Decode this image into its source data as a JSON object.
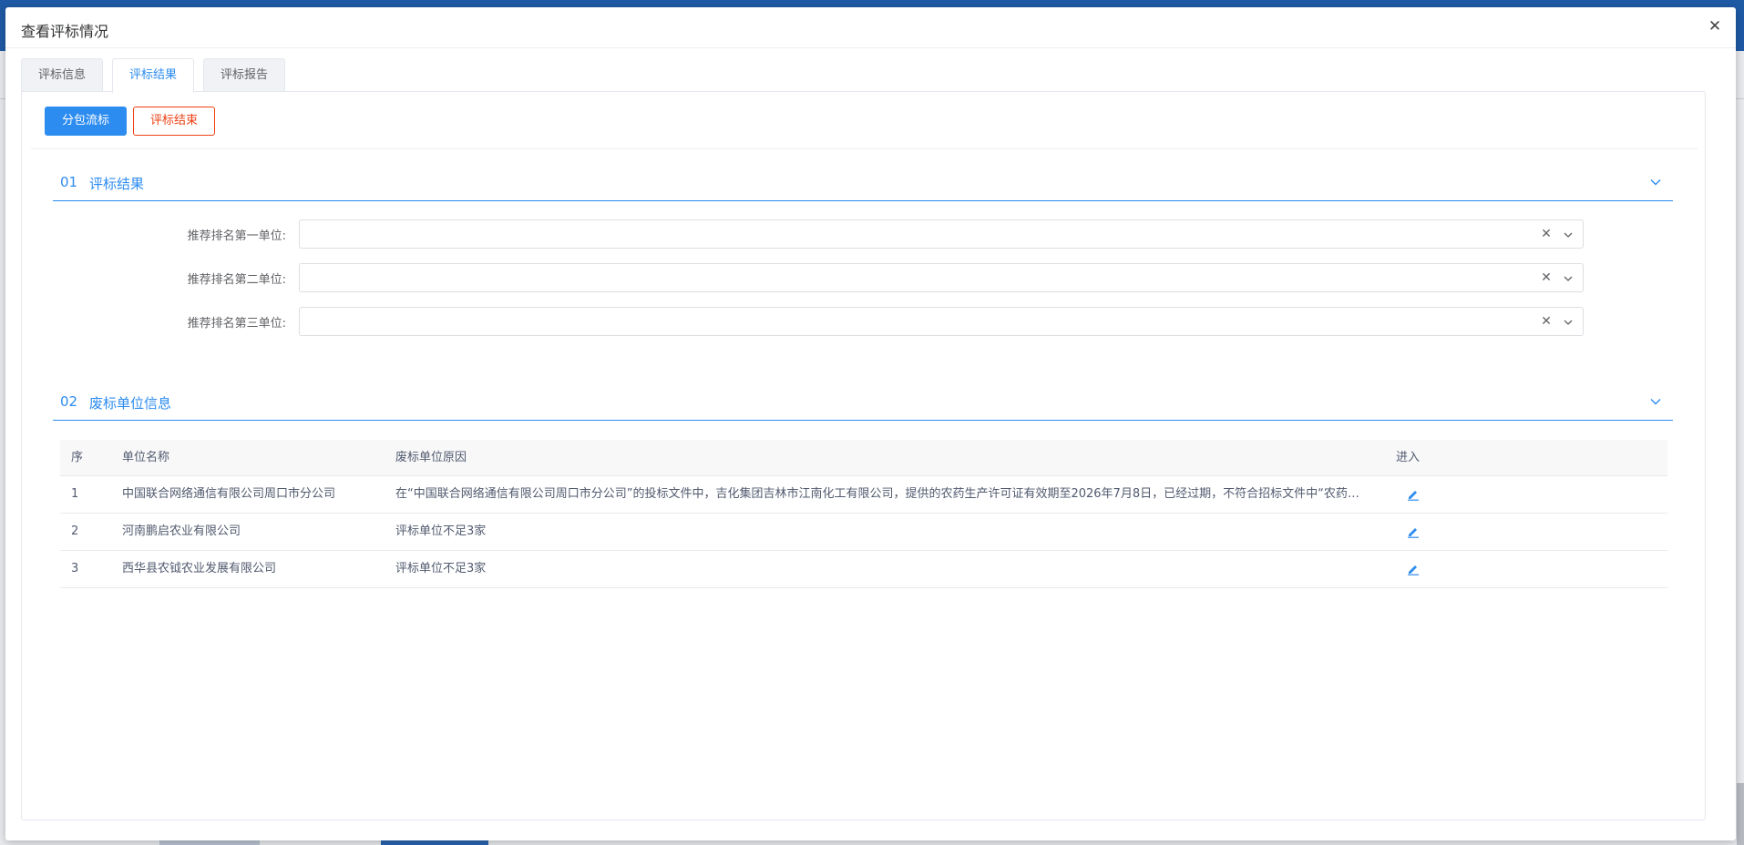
{
  "dialog": {
    "title": "查看评标情况",
    "close_icon": "close-icon"
  },
  "tabs": [
    {
      "label": "评标信息",
      "active": false
    },
    {
      "label": "评标结果",
      "active": true
    },
    {
      "label": "评标报告",
      "active": false
    }
  ],
  "toolbar": {
    "split_label": "分包流标",
    "end_label": "评标结束"
  },
  "section1": {
    "num": "01",
    "title": "评标结果"
  },
  "form": {
    "rank1_label": "推荐排名第一单位:",
    "rank1_value": "",
    "rank2_label": "推荐排名第二单位:",
    "rank2_value": "",
    "rank3_label": "推荐排名第三单位:",
    "rank3_value": ""
  },
  "section2": {
    "num": "02",
    "title": "废标单位信息"
  },
  "table": {
    "headers": {
      "idx": "序",
      "name": "单位名称",
      "reason": "废标单位原因",
      "enter": "进入"
    },
    "rows": [
      {
        "idx": "1",
        "name": "中国联合网络通信有限公司周口市分公司",
        "reason": "在“中国联合网络通信有限公司周口市分公司”的投标文件中，吉化集团吉林市江南化工有限公司，提供的农药生产许可证有效期至2026年7月8日，已经过期，不符合招标文件中“农药产品必须“三证”(生产许可证..."
      },
      {
        "idx": "2",
        "name": "河南鹏启农业有限公司",
        "reason": "评标单位不足3家"
      },
      {
        "idx": "3",
        "name": "西华县农钺农业发展有限公司",
        "reason": "评标单位不足3家"
      }
    ]
  },
  "colors": {
    "accent": "#2d8cf0",
    "danger": "#ed4014"
  }
}
